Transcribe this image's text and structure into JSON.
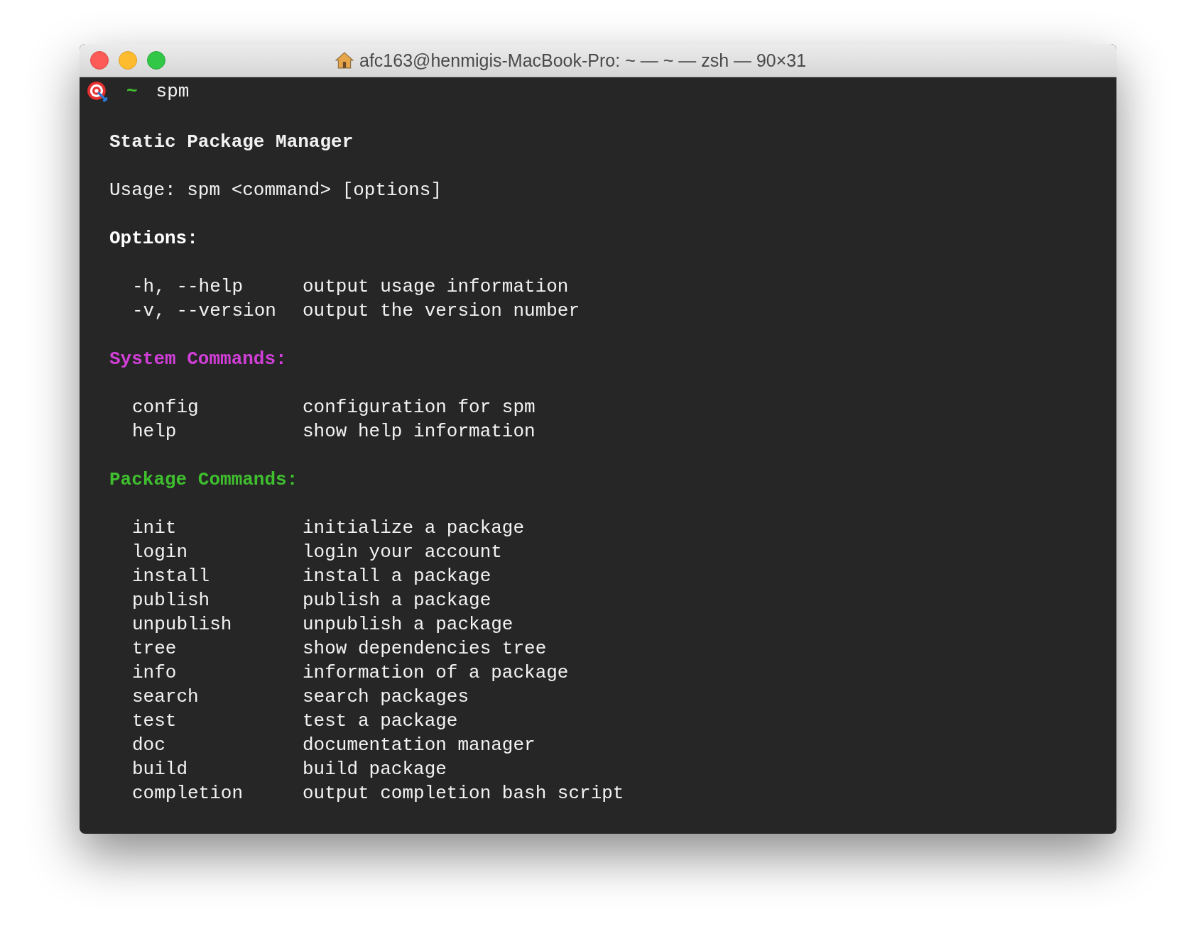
{
  "window": {
    "title": "afc163@henmigis-MacBook-Pro: ~ — ~ — zsh — 90×31"
  },
  "prompt": {
    "directory": "~",
    "command": "spm"
  },
  "heading": "Static Package Manager",
  "usage": "Usage: spm <command> [options]",
  "sections": [
    {
      "title": "Options:",
      "color": "#ffffff",
      "rows": [
        {
          "name": "-h, --help",
          "description": "output usage information"
        },
        {
          "name": "-v, --version",
          "description": "output the version number"
        }
      ]
    },
    {
      "title": "System Commands:",
      "color": "#d23fd8",
      "rows": [
        {
          "name": "config",
          "description": "configuration for spm"
        },
        {
          "name": "help",
          "description": "show help information"
        }
      ]
    },
    {
      "title": "Package Commands:",
      "color": "#3fbf2e",
      "rows": [
        {
          "name": "init",
          "description": "initialize a package"
        },
        {
          "name": "login",
          "description": "login your account"
        },
        {
          "name": "install",
          "description": "install a package"
        },
        {
          "name": "publish",
          "description": "publish a package"
        },
        {
          "name": "unpublish",
          "description": "unpublish a package"
        },
        {
          "name": "tree",
          "description": "show dependencies tree"
        },
        {
          "name": "info",
          "description": "information of a package"
        },
        {
          "name": "search",
          "description": "search packages"
        },
        {
          "name": "test",
          "description": "test a package"
        },
        {
          "name": "doc",
          "description": "documentation manager"
        },
        {
          "name": "build",
          "description": "build package"
        },
        {
          "name": "completion",
          "description": "output completion bash script"
        }
      ]
    }
  ]
}
